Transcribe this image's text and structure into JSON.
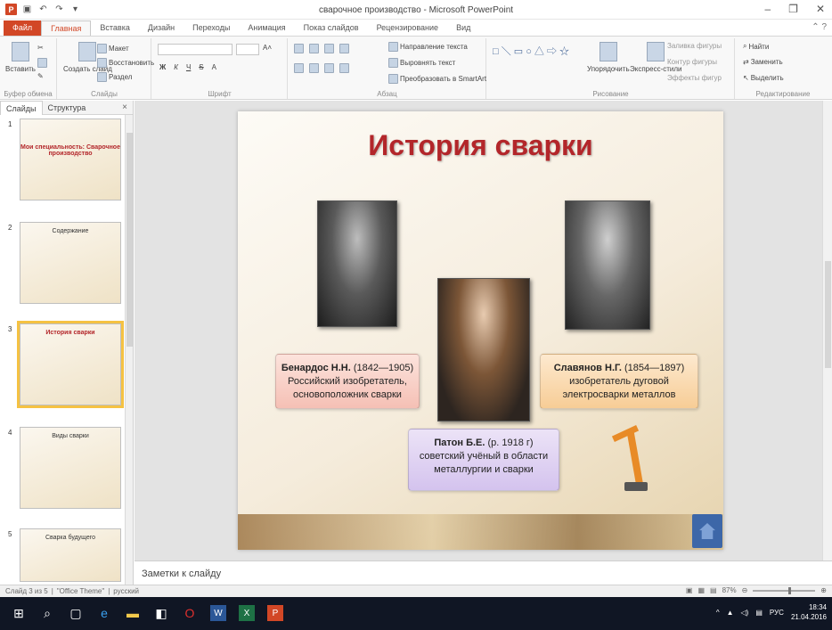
{
  "window": {
    "title": "сварочное производство - Microsoft PowerPoint",
    "minimize": "–",
    "maximize": "❐",
    "close": "✕"
  },
  "tabs": [
    "Файл",
    "Главная",
    "Вставка",
    "Дизайн",
    "Переходы",
    "Анимация",
    "Показ слайдов",
    "Рецензирование",
    "Вид"
  ],
  "ribbon": {
    "clipboard": {
      "paste": "Вставить",
      "label": "Буфер обмена"
    },
    "slides": {
      "new_slide": "Создать слайд",
      "layout": "Макет",
      "reset": "Восстановить",
      "section": "Раздел",
      "label": "Слайды"
    },
    "font": {
      "label": "Шрифт",
      "bold": "Ж",
      "italic": "К",
      "underline": "Ч",
      "strike": "S"
    },
    "paragraph": {
      "label": "Абзац",
      "text_dir": "Направление текста",
      "align_text": "Выровнять текст",
      "smartart": "Преобразовать в SmartArt"
    },
    "drawing": {
      "label": "Рисование",
      "arrange": "Упорядочить",
      "quick_styles": "Экспресс-стили",
      "fill": "Заливка фигуры",
      "outline": "Контур фигуры",
      "effects": "Эффекты фигур"
    },
    "editing": {
      "label": "Редактирование",
      "find": "Найти",
      "replace": "Заменить",
      "select": "Выделить"
    }
  },
  "left_pane": {
    "tabs": [
      "Слайды",
      "Структура"
    ],
    "close": "×",
    "thumbnails": [
      {
        "num": "1",
        "title": "Мои специальность: Сварочное производство",
        "selected": false
      },
      {
        "num": "2",
        "title": "Содержание",
        "selected": false
      },
      {
        "num": "3",
        "title": "История сварки",
        "selected": true
      },
      {
        "num": "4",
        "title": "Виды сварки",
        "selected": false
      },
      {
        "num": "5",
        "title": "Сварка будущего",
        "selected": false
      }
    ]
  },
  "slide": {
    "title": "История сварки",
    "people": [
      {
        "name": "Бенардос Н.Н.",
        "years": "(1842—1905)",
        "desc": "Российский изобретатель, основоположник сварки"
      },
      {
        "name": "Славянов Н.Г.",
        "years": "(1854—1897)",
        "desc": "изобретатель дуговой электросварки металлов"
      },
      {
        "name": "Патон Б.Е.",
        "years": "(р. 1918 г)",
        "desc": "советский учёный в области металлургии и сварки"
      }
    ]
  },
  "notes": {
    "placeholder": "Заметки к слайду"
  },
  "status": {
    "slide": "Слайд 3 из 5",
    "theme": "\"Office Theme\"",
    "lang": "русский",
    "zoom": "87%"
  },
  "taskbar": {
    "lang": "РУС",
    "time": "18:34",
    "date": "21.04.2016"
  },
  "colors": {
    "accent": "#d24726",
    "slide_title": "#b3262a",
    "selection": "#f5c242"
  }
}
